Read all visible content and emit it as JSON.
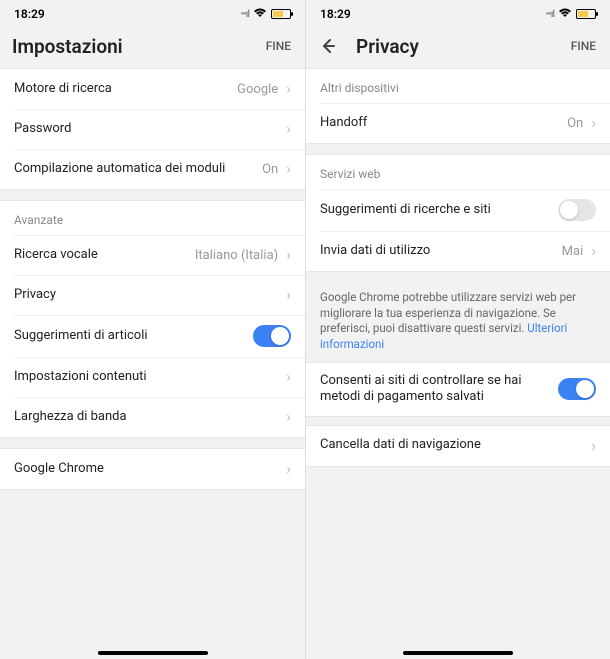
{
  "left": {
    "status": {
      "time": "18:29"
    },
    "header": {
      "title": "Impostazioni",
      "done": "FINE"
    },
    "group1": {
      "search_engine": {
        "label": "Motore di ricerca",
        "value": "Google"
      },
      "password": {
        "label": "Password"
      },
      "autofill": {
        "label": "Compilazione automatica dei moduli",
        "value": "On"
      }
    },
    "group2": {
      "header": "Avanzate",
      "voice_search": {
        "label": "Ricerca vocale",
        "value": "Italiano (Italia)"
      },
      "privacy": {
        "label": "Privacy"
      },
      "article_suggestions": {
        "label": "Suggerimenti di articoli"
      },
      "content_settings": {
        "label": "Impostazioni contenuti"
      },
      "bandwidth": {
        "label": "Larghezza di banda"
      }
    },
    "group3": {
      "chrome": {
        "label": "Google Chrome"
      }
    }
  },
  "right": {
    "status": {
      "time": "18:29"
    },
    "header": {
      "title": "Privacy",
      "done": "FINE"
    },
    "group1": {
      "header": "Altri dispositivi",
      "handoff": {
        "label": "Handoff",
        "value": "On"
      }
    },
    "group2": {
      "header": "Servizi web",
      "search_suggestions": {
        "label": "Suggerimenti di ricerche e siti"
      },
      "usage_data": {
        "label": "Invia dati di utilizzo",
        "value": "Mai"
      }
    },
    "info": {
      "text": "Google Chrome potrebbe utilizzare servizi web per migliorare la tua esperienza di navigazione. Se preferisci, puoi disattivare questi servizi. ",
      "link": "Ulteriori informazioni"
    },
    "group3": {
      "payment": {
        "label": "Consenti ai siti di controllare se hai metodi di pagamento salvati"
      }
    },
    "group4": {
      "clear": {
        "label": "Cancella dati di navigazione"
      }
    }
  }
}
